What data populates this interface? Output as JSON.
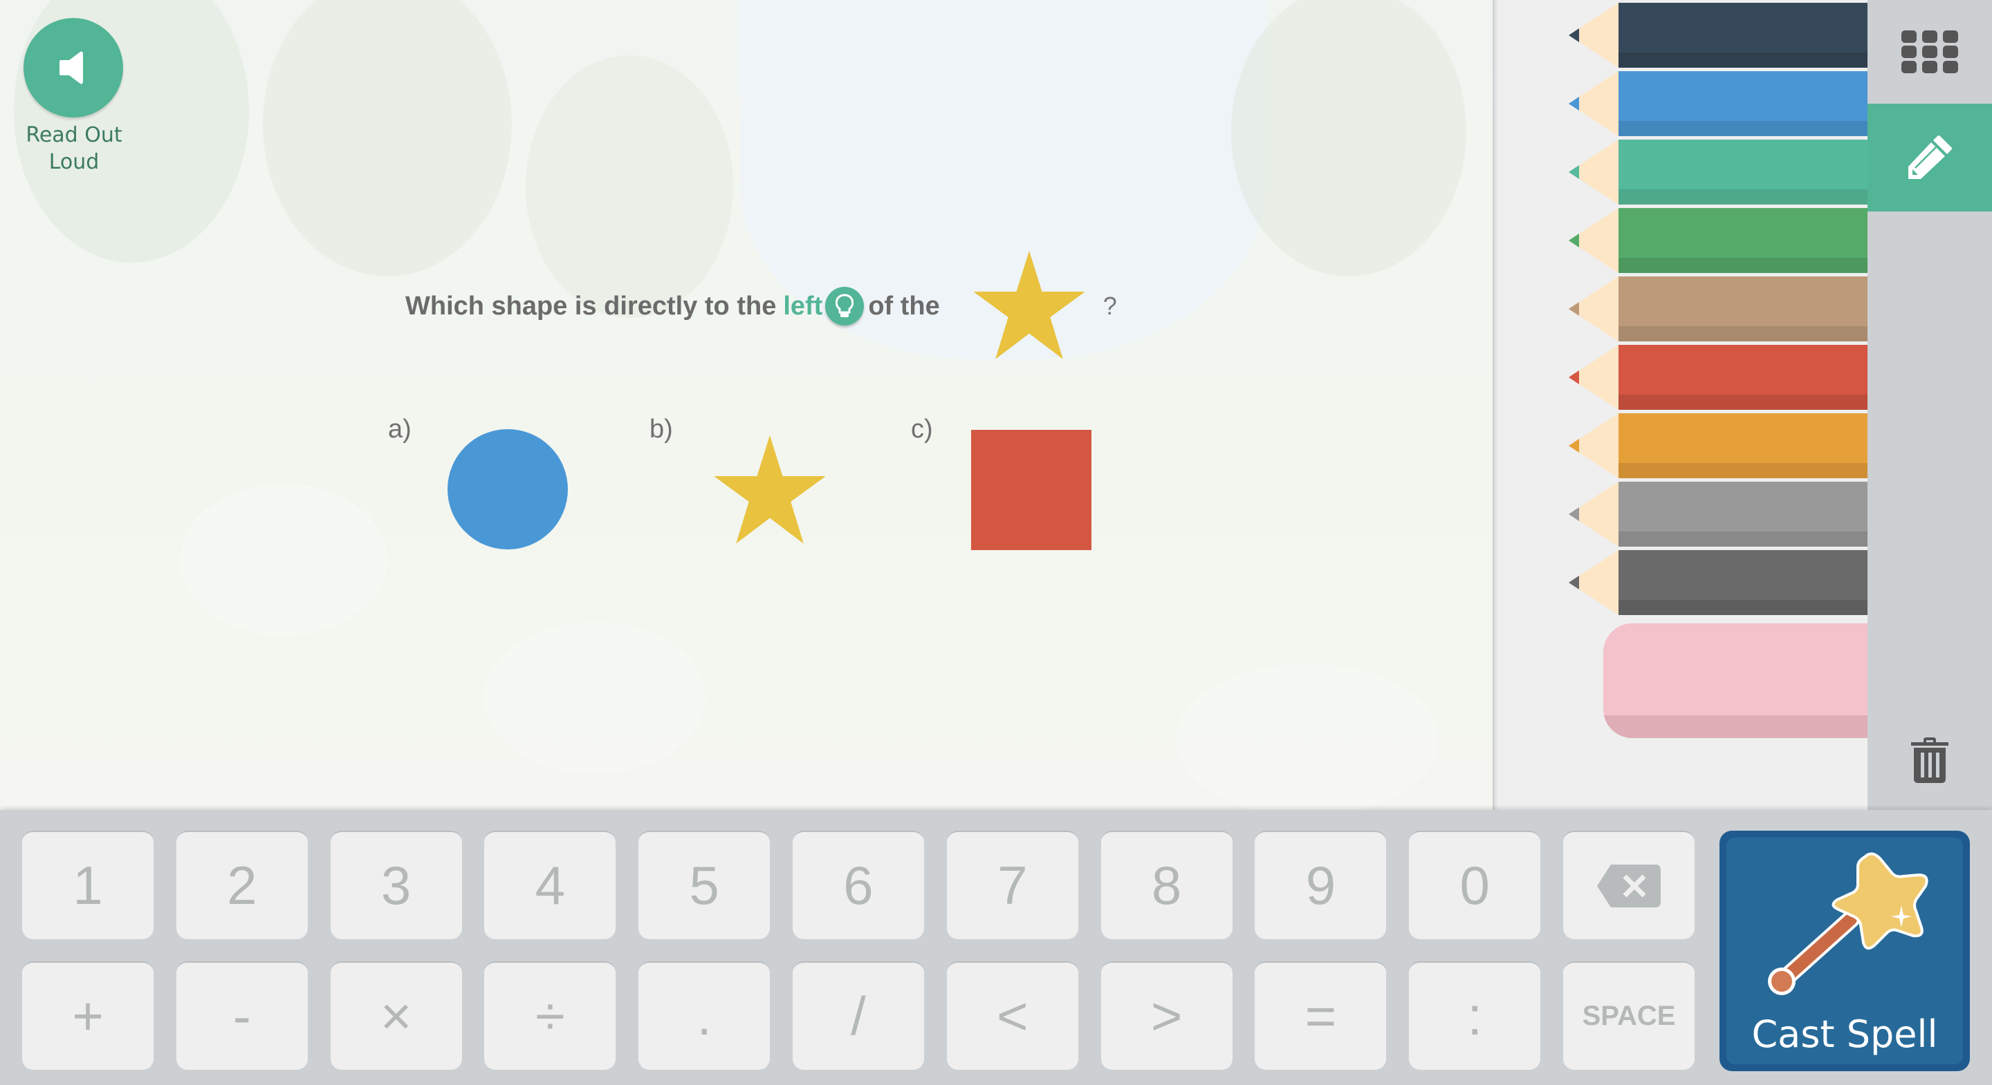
{
  "read_aloud": {
    "label": "Read Out Loud",
    "icon": "speaker-icon"
  },
  "question": {
    "prefix": "Which shape is directly to the",
    "keyword": "left",
    "suffix": "of the",
    "reference_shape": "star",
    "end": "?",
    "hint_icon": "lightbulb-icon"
  },
  "options": [
    {
      "label": "a)",
      "shape": "circle",
      "color": "#4a97d6"
    },
    {
      "label": "b)",
      "shape": "star",
      "color": "#e9c23f"
    },
    {
      "label": "c)",
      "shape": "square",
      "color": "#d45742"
    }
  ],
  "drawing": {
    "pencils": [
      {
        "name": "navy",
        "color": "#36495a",
        "shade": "#303f4e"
      },
      {
        "name": "blue",
        "color": "#4a96d4",
        "shade": "#4388bd"
      },
      {
        "name": "teal",
        "color": "#55b99b",
        "shade": "#4ea88a"
      },
      {
        "name": "green",
        "color": "#55aa69",
        "shade": "#4d985c"
      },
      {
        "name": "tan",
        "color": "#bd9a7a",
        "shade": "#a88b6d"
      },
      {
        "name": "red",
        "color": "#d45643",
        "shade": "#bd4c3b"
      },
      {
        "name": "orange",
        "color": "#e6a03a",
        "shade": "#cf8e33"
      },
      {
        "name": "gray",
        "color": "#999999",
        "shade": "#898989"
      },
      {
        "name": "dark-gray",
        "color": "#6a6a6a",
        "shade": "#5e5e5e"
      }
    ],
    "wood_color": "#fde6c6",
    "eraser": {
      "color": "#f4c2cb"
    },
    "tools": {
      "grid": "keypad-grid-icon",
      "pencil": "pencil-icon",
      "trash": "trash-icon",
      "active": "pencil"
    }
  },
  "keypad": {
    "row1": [
      "1",
      "2",
      "3",
      "4",
      "5",
      "6",
      "7",
      "8",
      "9",
      "0",
      "⌫"
    ],
    "row2": [
      "+",
      "-",
      "×",
      "÷",
      ".",
      "/",
      "<",
      ">",
      "=",
      ":",
      "SPACE"
    ],
    "submit": "Cast Spell"
  },
  "colors": {
    "accent": "#52b596",
    "cast_button": "#276a99"
  }
}
